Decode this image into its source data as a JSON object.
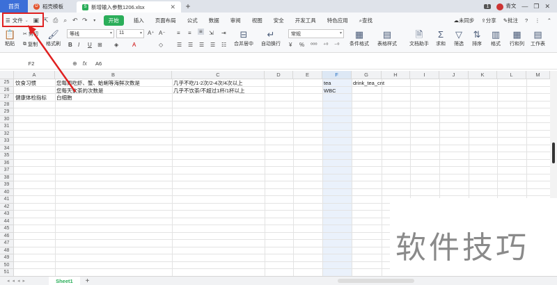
{
  "titlebar": {
    "home_tab": "首页",
    "template_tab": "稻壳模板",
    "file_tab": "新增输入参数1206.xlsx",
    "badge": "1",
    "user": "青文",
    "colors": {
      "home_tab_bg": "#3c6fd8",
      "template_icon": "#e2532d",
      "file_icon": "#2bae5a"
    }
  },
  "menu": {
    "file": "文件",
    "start": "开始",
    "items": [
      "插入",
      "页面布局",
      "公式",
      "数据",
      "审阅",
      "视图",
      "安全",
      "开发工具",
      "特色应用"
    ],
    "search": "查找",
    "sync": "未同步",
    "share": "分享",
    "comment": "批注"
  },
  "ribbon": {
    "paste": "粘贴",
    "cut": "剪切",
    "copy": "复制",
    "format_painter": "格式刷",
    "font_name": "等线",
    "font_size": "11",
    "merge": "合并居中",
    "wrap": "自动换行",
    "number_format": "常规",
    "cond_format": "条件格式",
    "table_style": "表格样式",
    "doc_helper": "文档助手",
    "sum": "求和",
    "filter": "筛选",
    "sort": "排序",
    "format": "格式",
    "row_col": "行和列",
    "worksheet": "工作表"
  },
  "formula_bar": {
    "name_box": "F2",
    "fx": "fx",
    "value": "A6"
  },
  "grid": {
    "columns": [
      "A",
      "B",
      "C",
      "D",
      "E",
      "F",
      "G",
      "H",
      "I",
      "J",
      "K",
      "L",
      "M"
    ],
    "selected_column": "F",
    "row_numbers": [
      "25",
      "26",
      "27",
      "28",
      "29",
      "30",
      "31",
      "32",
      "33",
      "34",
      "35",
      "36",
      "37",
      "38",
      "39",
      "40",
      "41",
      "42",
      "43",
      "44",
      "45",
      "46",
      "47",
      "48",
      "49",
      "50",
      "51"
    ],
    "cells": {
      "A25": "饮食习惯",
      "B25": "您每周吃虾、蟹、蛤蜊等海鲜次数是",
      "C25": "几乎不吃/1-2次/2-4次/4次以上",
      "F25": "tea",
      "G25": "drink_tea_cnt",
      "B26": "您每天饮茶的次数是",
      "C26": "几乎不饮茶/不超过1杯/1杯以上",
      "F26": "WBC",
      "A27": "健康体检指标",
      "B27": "白细胞"
    }
  },
  "sheets": {
    "tabs": [
      "Sheet1"
    ]
  },
  "watermark": "软件技巧"
}
